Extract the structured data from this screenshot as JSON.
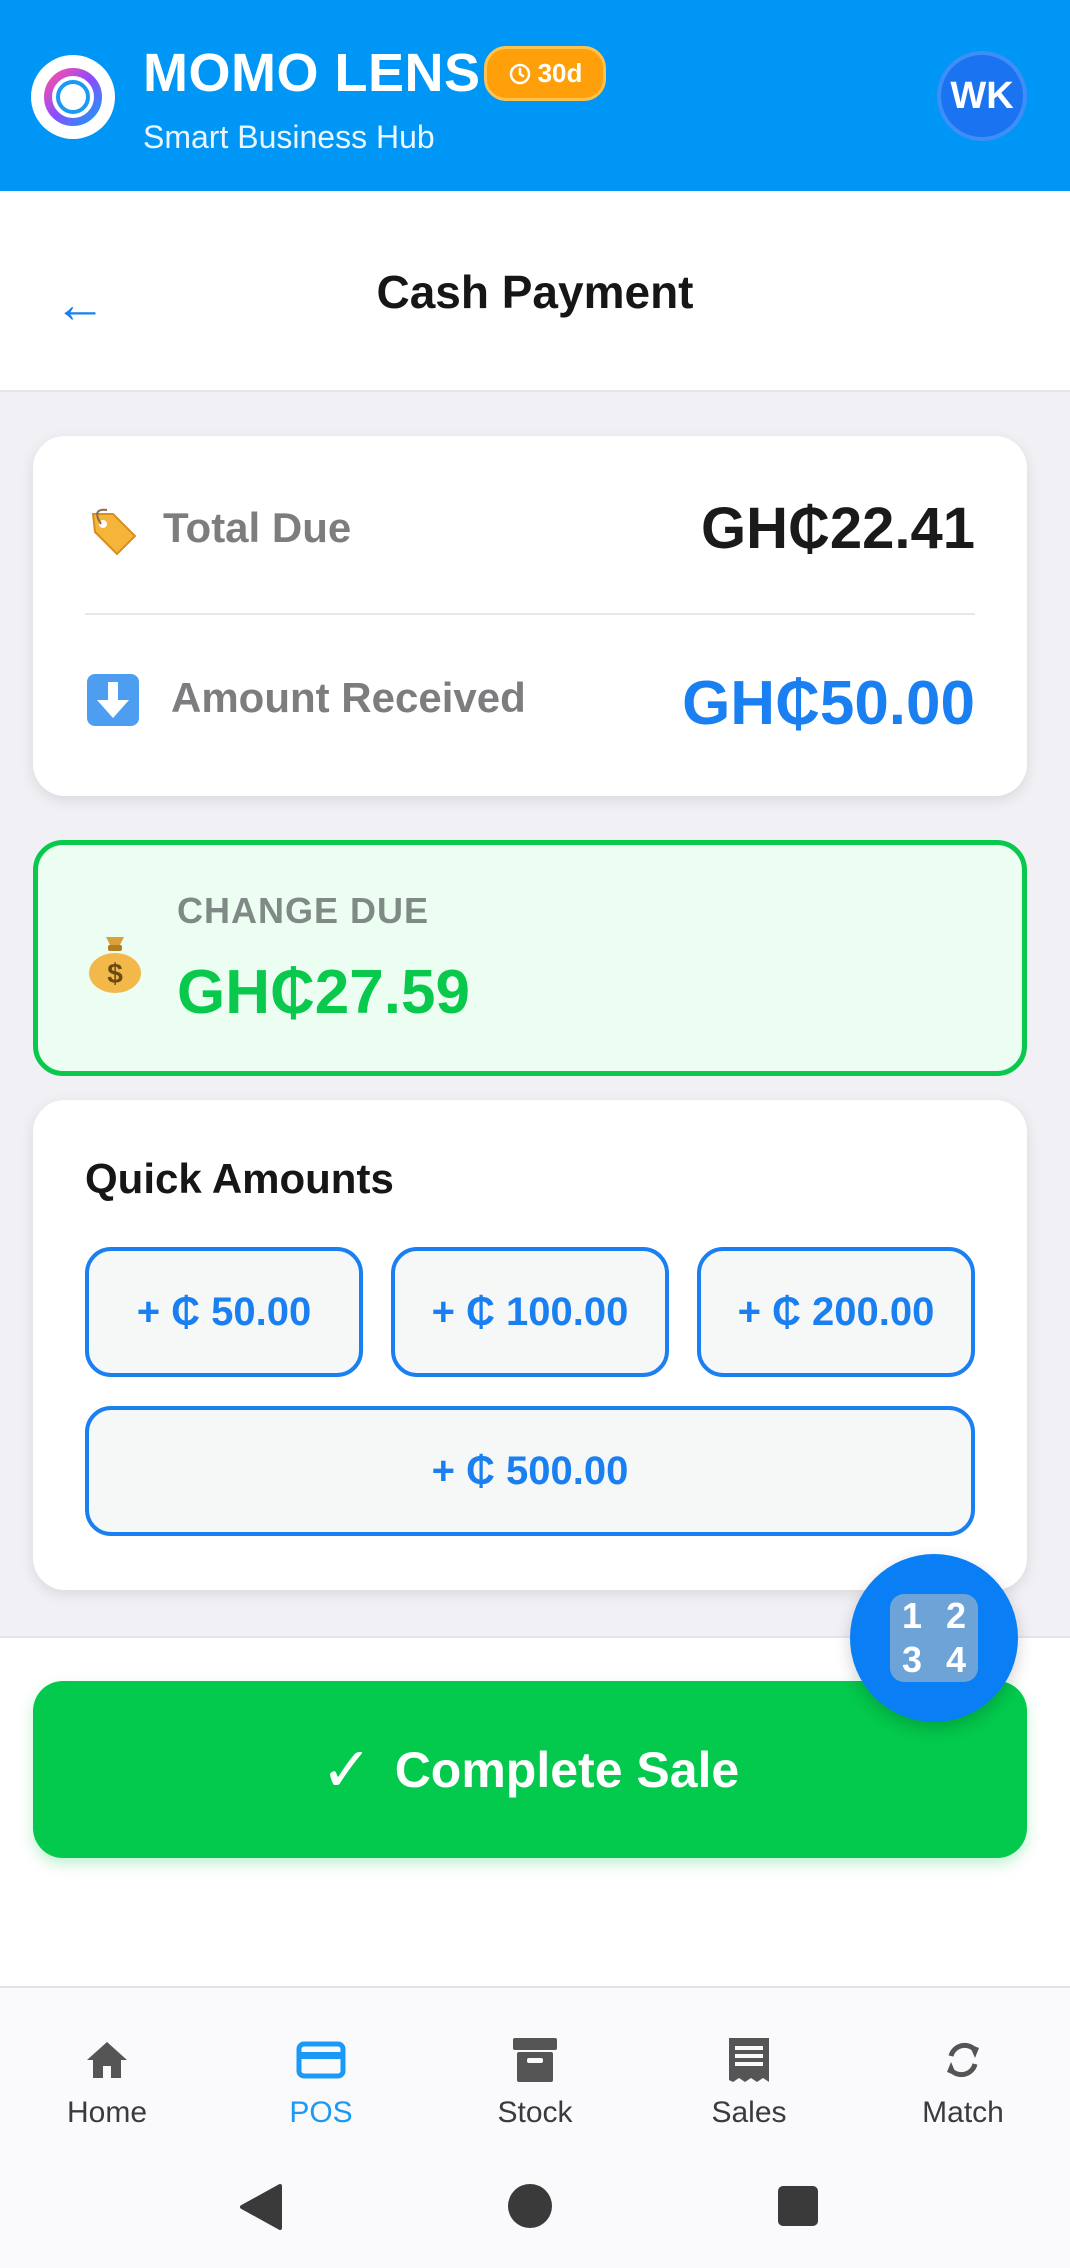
{
  "header": {
    "app_name": "MOMO LENS",
    "trial_badge": "30d",
    "tagline": "Smart Business Hub",
    "avatar_initials": "WK",
    "logo_icon": "ring-logo-icon",
    "colors": {
      "bar": "#0096f5",
      "badge": "#ff9f0a"
    }
  },
  "page": {
    "title": "Cash Payment",
    "back_icon": "←"
  },
  "totals": {
    "total_due_label": "Total Due",
    "total_due_value": "GH₵22.41",
    "amount_received_label": "Amount Received",
    "amount_received_value": "GH₵50.00"
  },
  "change": {
    "label": "CHANGE DUE",
    "value": "GH₵27.59",
    "icon": "money-bag-icon",
    "color": "#08c94c"
  },
  "quick_amounts": {
    "title": "Quick Amounts",
    "buttons": [
      "+ ₵ 50.00",
      "+ ₵ 100.00",
      "+ ₵ 200.00",
      "+ ₵ 500.00"
    ]
  },
  "keypad_fab": {
    "keys": [
      "1",
      "2",
      "3",
      "4"
    ]
  },
  "complete_sale": {
    "check": "✓",
    "label": "Complete Sale",
    "color": "#03c94c"
  },
  "nav": {
    "items": [
      {
        "label": "Home",
        "icon": "home-icon"
      },
      {
        "label": "POS",
        "icon": "card-icon",
        "active": true
      },
      {
        "label": "Stock",
        "icon": "archive-box-icon"
      },
      {
        "label": "Sales",
        "icon": "receipt-icon"
      },
      {
        "label": "Match",
        "icon": "sync-icon"
      }
    ],
    "active_color": "#1a9af5"
  }
}
